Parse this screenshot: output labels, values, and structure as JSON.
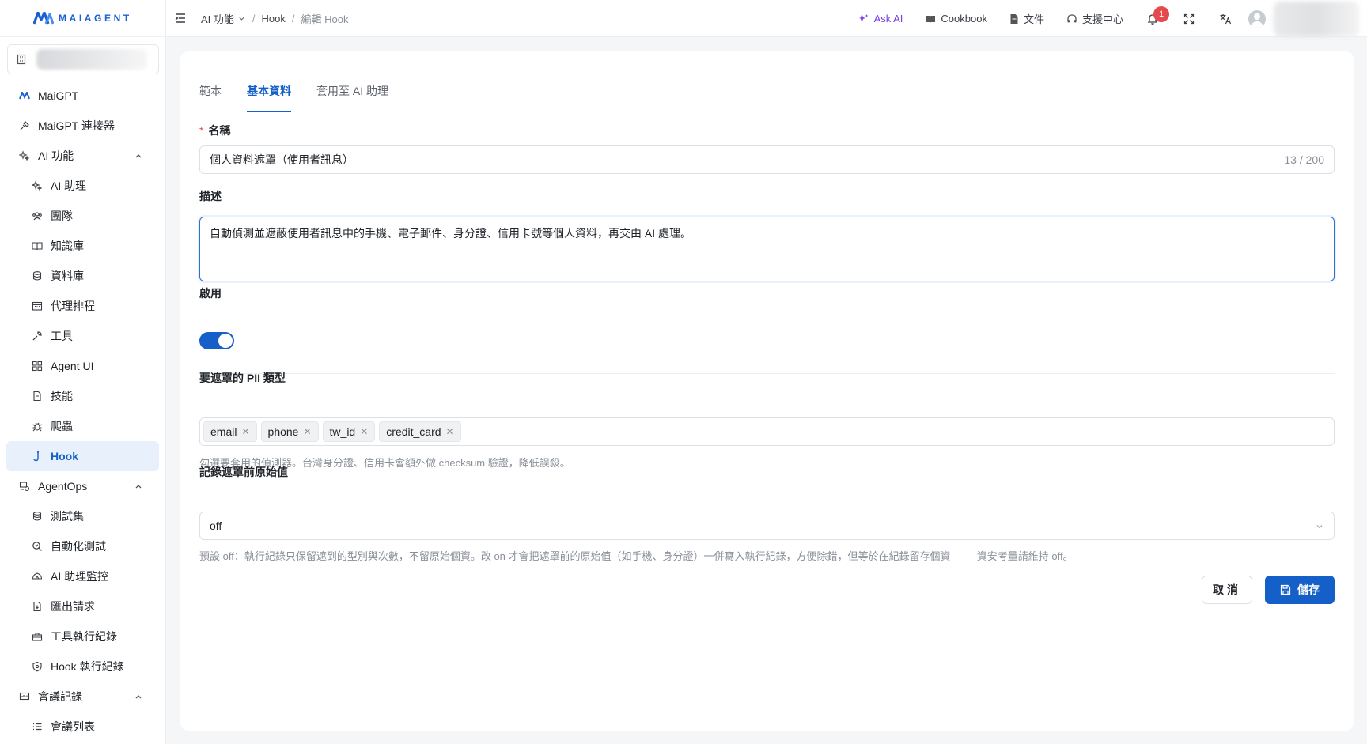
{
  "brand": {
    "name": "MAIAGENT",
    "color": "#1460c8"
  },
  "header": {
    "breadcrumb": [
      "AI 功能",
      "Hook",
      "編輯 Hook"
    ],
    "ask_ai": "Ask AI",
    "cookbook": "Cookbook",
    "docs": "文件",
    "support": "支援中心",
    "notifications": "1"
  },
  "sidebar": {
    "items": [
      {
        "label": "MaiGPT",
        "icon": "maigpt-icon"
      },
      {
        "label": "MaiGPT 連接器",
        "icon": "plug-icon"
      },
      {
        "label": "AI 功能",
        "icon": "sparkle-icon",
        "expanded": true
      },
      {
        "label": "AI 助理",
        "icon": "sparkle-icon"
      },
      {
        "label": "團隊",
        "icon": "team-icon"
      },
      {
        "label": "知識庫",
        "icon": "book-icon"
      },
      {
        "label": "資料庫",
        "icon": "database-icon"
      },
      {
        "label": "代理排程",
        "icon": "calendar-icon"
      },
      {
        "label": "工具",
        "icon": "wrench-icon"
      },
      {
        "label": "Agent UI",
        "icon": "grid-icon"
      },
      {
        "label": "技能",
        "icon": "file-icon"
      },
      {
        "label": "爬蟲",
        "icon": "bug-icon"
      },
      {
        "label": "Hook",
        "icon": "hook-icon",
        "active": true
      },
      {
        "label": "AgentOps",
        "icon": "agentops-icon",
        "expanded": true
      },
      {
        "label": "測試集",
        "icon": "database-icon"
      },
      {
        "label": "自動化測試",
        "icon": "search-icon"
      },
      {
        "label": "AI 助理監控",
        "icon": "monitor-icon"
      },
      {
        "label": "匯出請求",
        "icon": "export-icon"
      },
      {
        "label": "工具執行紀錄",
        "icon": "toolbox-icon"
      },
      {
        "label": "Hook 執行紀錄",
        "icon": "shield-icon"
      },
      {
        "label": "會議記錄",
        "icon": "meeting-icon",
        "expanded": true
      },
      {
        "label": "會議列表",
        "icon": "list-icon"
      }
    ]
  },
  "tabs": [
    "範本",
    "基本資料",
    "套用至 AI 助理"
  ],
  "form": {
    "name_label": "名稱",
    "name_value": "個人資料遮罩（使用者訊息）",
    "name_count": "13 / 200",
    "desc_label": "描述",
    "desc_value": "自動偵測並遮蔽使用者訊息中的手機、電子郵件、身分證、信用卡號等個人資料，再交由 AI 處理。",
    "enable_label": "啟用",
    "enabled": true,
    "pii_label": "要遮罩的 PII 類型",
    "pii_tags": [
      "email",
      "phone",
      "tw_id",
      "credit_card"
    ],
    "pii_hint": "勾選要套用的偵測器。台灣身分證、信用卡會額外做 checksum 驗證，降低誤殺。",
    "log_label": "記錄遮罩前原始值",
    "log_value": "off",
    "log_hint": "預設 off：執行紀錄只保留遮到的型別與次數，不留原始個資。改 on 才會把遮罩前的原始值（如手機、身分證）一併寫入執行紀錄，方便除錯，但等於在紀錄留存個資 —— 資安考量請維持 off。"
  },
  "buttons": {
    "cancel": "取消",
    "save": "儲存"
  }
}
